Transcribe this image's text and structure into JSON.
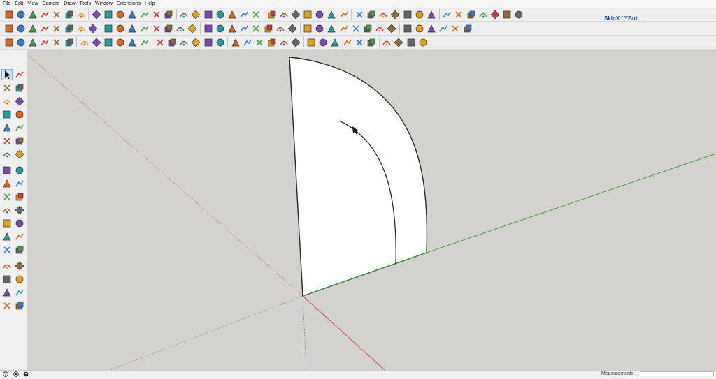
{
  "menu": [
    "File",
    "Edit",
    "View",
    "Camera",
    "Draw",
    "Tools",
    "Window",
    "Extensions",
    "Help"
  ],
  "toolbar": {
    "skin_label": "SkinX / YBub"
  },
  "status": {
    "measurements_label": "Measurements",
    "measurements_value": ""
  },
  "colors": {
    "viewport_bg": "#d4d2cf",
    "face": "#ffffff",
    "edge": "#2b2b2b",
    "axis_red": "#d04040",
    "axis_green": "#3a9a3a",
    "axis_blue": "#2f5bd0"
  },
  "icons": {
    "row1": [
      "sketchup-logo",
      "play-icon",
      "stop-icon",
      "prev-icon",
      "scene-icon",
      "person-icon",
      "rotate-icon",
      "arrows-icon",
      "push-icon",
      "pull-icon",
      "diamond-icon",
      "shape-icon",
      "cloud-icon",
      "wave-icon",
      "spring-icon",
      "grid-icon",
      "hand-icon",
      "arc-icon",
      "arc2-icon",
      "curve-icon",
      "curve2-icon",
      "blob-icon",
      "triangle-icon",
      "grid-stack-icon",
      "mesh-icon",
      "globe-icon",
      "leaf-icon",
      "cube-icon",
      "fold-icon",
      "pen-icon",
      "pen2-icon",
      "pen3-icon",
      "chair-icon",
      "stair-icon",
      "layers-icon",
      "stack-icon",
      "tiles-icon",
      "fold2-icon",
      "flip-icon",
      "book-icon",
      "face-icon",
      "rock-icon"
    ],
    "row2": [
      "axis-x-icon",
      "axis-y-icon",
      "axis-z-icon",
      "axis-w-icon",
      "axis-v-icon",
      "axis-n-icon",
      "axis-e-icon",
      "axis-f-icon",
      "draw-icon",
      "line-icon",
      "paint-icon",
      "select-box-icon",
      "terrain-icon",
      "drop-icon",
      "camera-icon",
      "print-icon",
      "video-icon",
      "box-icon",
      "clone-icon",
      "bag-icon",
      "lock-icon",
      "key-icon",
      "pan-icon",
      "caret-icon",
      "peak-icon",
      "cursor-icon",
      "spline-icon",
      "x-icon",
      "y-icon",
      "z-icon",
      "w-icon",
      "cube-color-icon",
      "sphere-icon",
      "shape2-icon",
      "book2-icon",
      "roof-icon",
      "terrain2-icon",
      "plane-icon"
    ],
    "row3": [
      "cube-iso-icon",
      "cube-top-icon",
      "cube-front-icon",
      "cube-right-icon",
      "cube-back-icon",
      "cube-left-icon",
      "bricks-icon",
      "tree-icon",
      "people-icon",
      "man-icon",
      "hatch-icon",
      "hatch2-icon",
      "hatch3-icon",
      "hatch4-icon",
      "dot-icon",
      "tool-cross-icon",
      "circle-icon",
      "teapot-icon",
      "teapot2-icon",
      "frame-icon",
      "frame2-icon",
      "frame3-icon",
      "lock2-icon",
      "car-icon",
      "cube-open-icon",
      "paper-icon",
      "paper2-icon",
      "filter-icon",
      "tree2-icon",
      "triangle2-icon",
      "star-icon",
      "half-circle-icon",
      "circle2-icon",
      "sun-icon"
    ],
    "left": [
      "select-icon",
      "eraser-icon",
      "paint-bucket-icon",
      "eraser2-icon",
      "pencil-icon",
      "freehand-icon",
      "rectangle-icon",
      "rotated-rect-icon",
      "circle-icon",
      "polygon-icon",
      "arc-icon",
      "arc3-icon",
      "pie-icon",
      "arc2-icon",
      "move-icon",
      "push-pull-icon",
      "rotate-icon",
      "follow-me-icon",
      "scale-icon",
      "offset-icon",
      "tape-icon",
      "dimension-icon",
      "protractor-icon",
      "text-icon",
      "axes-icon",
      "3d-text-icon",
      "orbit-icon",
      "pan-icon",
      "zoom-icon",
      "zoom-window-icon",
      "zoom-extents-icon",
      "previous-icon",
      "position-camera-icon",
      "look-around-icon",
      "walk-icon",
      "section-icon"
    ]
  }
}
